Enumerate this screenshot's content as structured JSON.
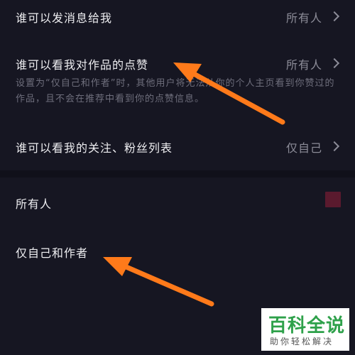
{
  "settings": {
    "rows": [
      {
        "label": "谁可以发消息给我",
        "value": "所有人"
      },
      {
        "label": "谁可以看我对作品的点赞",
        "value": "所有人",
        "description": "设置为“仅自己和作者”时，其他用户将无法从你的个人主页看到你赞过的作品，且不会在推荐中看到你的点赞信息。"
      },
      {
        "label": "谁可以看我的关注、粉丝列表",
        "value": "仅自己"
      }
    ]
  },
  "options_sheet": {
    "options": [
      {
        "label": "所有人",
        "selected": true
      },
      {
        "label": "仅自己和作者",
        "selected": false
      }
    ],
    "selected_color": "#5a1a2e"
  },
  "annotation": {
    "arrow_color": "#ff7a1a"
  },
  "watermark": {
    "title": "百科全说",
    "subtitle": "助你轻松解决"
  }
}
